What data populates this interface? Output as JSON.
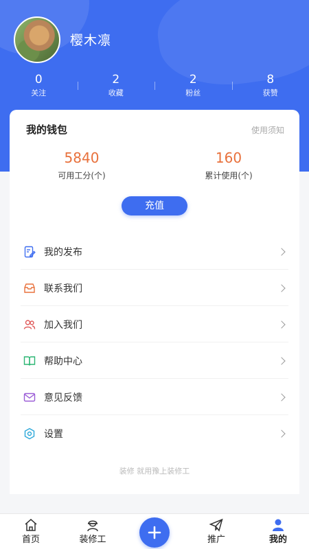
{
  "profile": {
    "username": "樱木凛"
  },
  "stats": [
    {
      "value": "0",
      "label": "关注"
    },
    {
      "value": "2",
      "label": "收藏"
    },
    {
      "value": "2",
      "label": "粉丝"
    },
    {
      "value": "8",
      "label": "获赞"
    }
  ],
  "wallet": {
    "title": "我的钱包",
    "note": "使用须知",
    "points_value": "5840",
    "points_label": "可用工分(个)",
    "used_value": "160",
    "used_label": "累计使用(个)",
    "recharge_label": "充值"
  },
  "menu": [
    {
      "label": "我的发布",
      "icon": "edit-document-icon",
      "color": "#3e6df0"
    },
    {
      "label": "联系我们",
      "icon": "mailbox-icon",
      "color": "#e8713c"
    },
    {
      "label": "加入我们",
      "icon": "users-icon",
      "color": "#e05a5a"
    },
    {
      "label": "帮助中心",
      "icon": "book-icon",
      "color": "#2bb673"
    },
    {
      "label": "意见反馈",
      "icon": "envelope-icon",
      "color": "#9a5bd6"
    },
    {
      "label": "设置",
      "icon": "settings-hexagon-icon",
      "color": "#2aa7d9"
    }
  ],
  "slogan": "装修 就用豫上装修工",
  "tabs": [
    {
      "label": "首页",
      "icon": "home-icon"
    },
    {
      "label": "装修工",
      "icon": "worker-icon"
    },
    {
      "label": "推广",
      "icon": "paper-plane-icon"
    },
    {
      "label": "我的",
      "icon": "person-icon",
      "active": true
    }
  ],
  "colors": {
    "primary": "#3e6df0",
    "accent_orange": "#e8713c",
    "background": "#f5f6f8"
  }
}
